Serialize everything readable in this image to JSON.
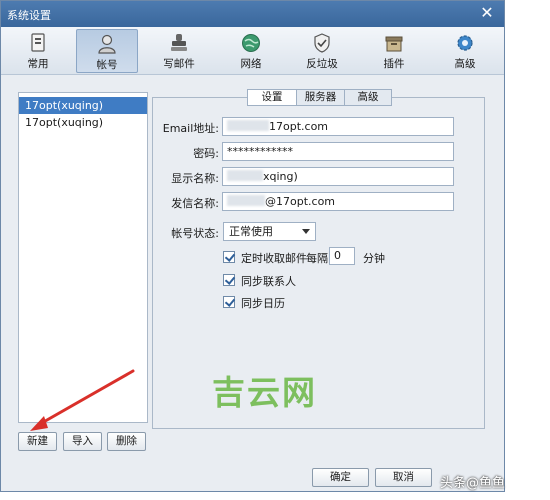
{
  "window": {
    "title": "系统设置",
    "close_label": "✕"
  },
  "toolbar": {
    "items": [
      {
        "label": "常用",
        "icon": "doc-icon"
      },
      {
        "label": "帐号",
        "icon": "user-icon"
      },
      {
        "label": "写邮件",
        "icon": "stamp-icon"
      },
      {
        "label": "网络",
        "icon": "globe-icon"
      },
      {
        "label": "反垃圾",
        "icon": "shield-icon"
      },
      {
        "label": "插件",
        "icon": "box-icon"
      },
      {
        "label": "高级",
        "icon": "gear-icon"
      }
    ],
    "active": "帐号"
  },
  "accounts": {
    "items": [
      "17opt(xuqing)",
      "17opt(xuqing)"
    ],
    "selected_index": 0
  },
  "left_buttons": {
    "new": "新建",
    "import": "导入",
    "delete": "删除"
  },
  "tabs": {
    "items": [
      "设置",
      "服务器",
      "高级"
    ],
    "active": "设置"
  },
  "form": {
    "email_label": "Email地址:",
    "email_value": "17opt.com",
    "password_label": "密码:",
    "password_value": "************",
    "display_label": "显示名称:",
    "display_value": "xqing)",
    "sender_label": "发信名称:",
    "sender_value": "@17opt.com",
    "status_label": "帐号状态:",
    "status_value": "正常使用"
  },
  "options": {
    "auto_fetch_label": "定时收取邮件",
    "every_label": "每隔",
    "interval_value": "0",
    "minute_label": "分钟",
    "sync_contacts_label": "同步联系人",
    "sync_calendar_label": "同步日历"
  },
  "footer": {
    "ok": "确定",
    "cancel": "取消"
  },
  "watermark": {
    "text": "吉云网",
    "source": "头条@鱼鱼"
  },
  "colors": {
    "titlebar": "#3f6ea5",
    "selection": "#3f7cc4",
    "watermark_green": "#7dbf5e",
    "annotation_red": "#d9302a"
  }
}
